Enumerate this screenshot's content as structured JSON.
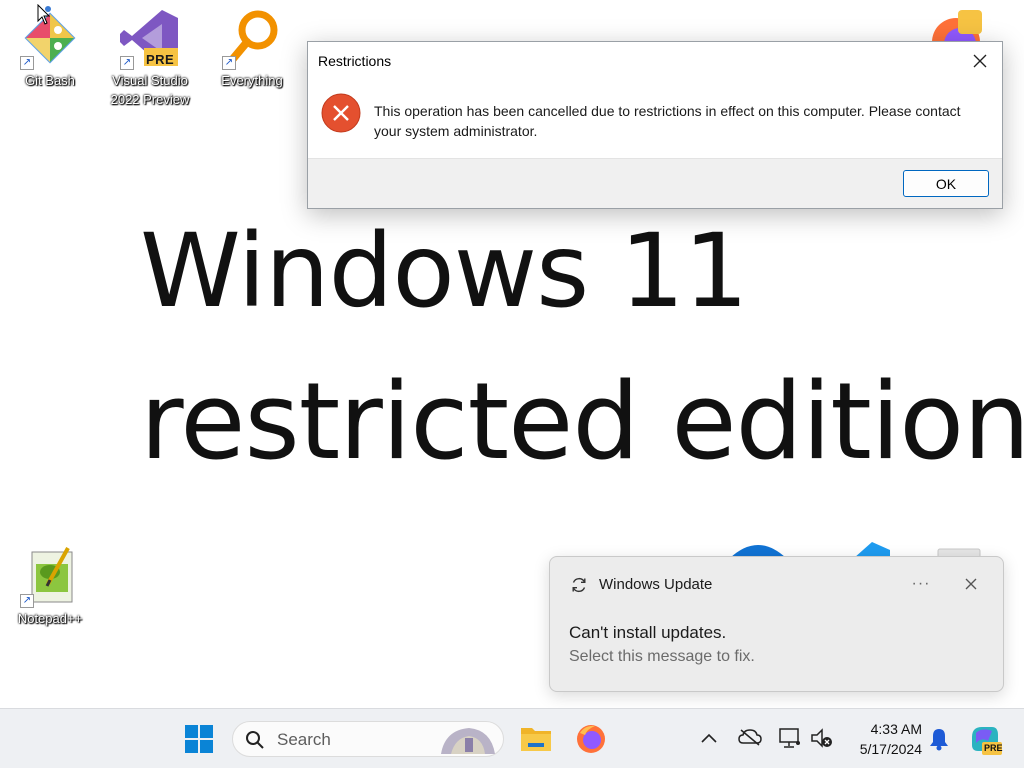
{
  "wallpaper": {
    "line1": "Windows 11",
    "line2": "restricted edition"
  },
  "desktop": {
    "icons": [
      {
        "label": "Git Bash",
        "icon": "git-bash-icon"
      },
      {
        "label": "Visual Studio 2022 Preview",
        "icon": "visual-studio-preview-icon",
        "badge": "PRE"
      },
      {
        "label": "Everything",
        "icon": "everything-search-icon"
      },
      {
        "label": "Notepad++",
        "icon": "notepad-plus-plus-icon"
      }
    ]
  },
  "dialog": {
    "title": "Restrictions",
    "message": "This operation has been cancelled due to restrictions in effect on this computer. Please contact your system administrator.",
    "ok_label": "OK",
    "icon": "error-icon"
  },
  "toast": {
    "app_name": "Windows Update",
    "title": "Can't install updates.",
    "subtitle": "Select this message to fix.",
    "more_label": "···"
  },
  "taskbar": {
    "search_placeholder": "Search",
    "clock_time": "4:33 AM",
    "clock_date": "5/17/2024",
    "copilot_badge": "PRE"
  },
  "colors": {
    "error_red": "#e4502f",
    "accent_blue": "#0067c0",
    "windows_blue": "#0a84d6"
  }
}
